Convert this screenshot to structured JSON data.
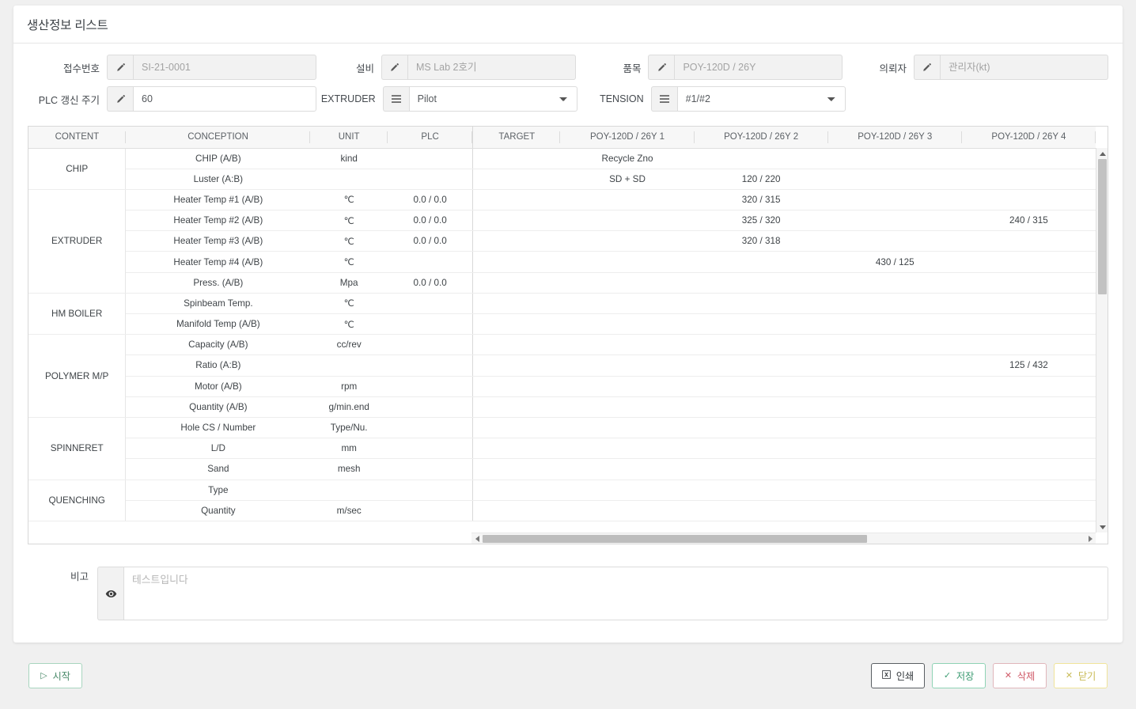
{
  "header": {
    "title": "생산정보 리스트"
  },
  "form": {
    "fields": [
      {
        "label": "접수번호",
        "icon": "pencil-icon",
        "value": "",
        "placeholder": "SI-21-0001",
        "type": "text",
        "readonly": true
      },
      {
        "label": "설비",
        "icon": "pencil-icon",
        "value": "",
        "placeholder": "MS Lab 2호기",
        "type": "text",
        "readonly": true
      },
      {
        "label": "품목",
        "icon": "pencil-icon",
        "value": "",
        "placeholder": "POY-120D / 26Y",
        "type": "text",
        "readonly": true
      },
      {
        "label": "의뢰자",
        "icon": "pencil-icon",
        "value": "",
        "placeholder": "관리자(kt)",
        "type": "text",
        "readonly": true
      },
      {
        "label": "PLC 갱신 주기",
        "icon": "pencil-icon",
        "value": "60",
        "placeholder": "",
        "type": "text",
        "readonly": false
      },
      {
        "label": "EXTRUDER",
        "icon": "list-icon",
        "value": "Pilot",
        "type": "select",
        "options": [
          "Pilot"
        ]
      },
      {
        "label": "TENSION",
        "icon": "list-icon",
        "value": "#1/#2",
        "type": "select",
        "options": [
          "#1/#2"
        ]
      }
    ]
  },
  "table": {
    "columns": [
      "CONTENT",
      "CONCEPTION",
      "UNIT",
      "PLC",
      "TARGET",
      "POY-120D / 26Y 1",
      "POY-120D / 26Y 2",
      "POY-120D / 26Y 3",
      "POY-120D / 26Y 4"
    ],
    "groups": [
      {
        "name": "CHIP",
        "rows": [
          {
            "conception": "CHIP (A/B)",
            "unit": "kind",
            "plc": "",
            "target": "",
            "c1": "Recycle Zno",
            "c2": "",
            "c3": "",
            "c4": ""
          },
          {
            "conception": "Luster (A:B)",
            "unit": "",
            "plc": "",
            "target": "",
            "c1": "SD + SD",
            "c2": "120 / 220",
            "c3": "",
            "c4": ""
          }
        ]
      },
      {
        "name": "EXTRUDER",
        "rows": [
          {
            "conception": "Heater Temp #1 (A/B)",
            "unit": "℃",
            "plc": "0.0 / 0.0",
            "target": "",
            "c1": "",
            "c2": "320 / 315",
            "c3": "",
            "c4": ""
          },
          {
            "conception": "Heater Temp #2 (A/B)",
            "unit": "℃",
            "plc": "0.0 / 0.0",
            "target": "",
            "c1": "",
            "c2": "325 / 320",
            "c3": "",
            "c4": "240 / 315"
          },
          {
            "conception": "Heater Temp #3 (A/B)",
            "unit": "℃",
            "plc": "0.0 / 0.0",
            "target": "",
            "c1": "",
            "c2": "320 / 318",
            "c3": "",
            "c4": ""
          },
          {
            "conception": "Heater Temp #4 (A/B)",
            "unit": "℃",
            "plc": "",
            "target": "",
            "c1": "",
            "c2": "",
            "c3": "430 / 125",
            "c4": ""
          },
          {
            "conception": "Press. (A/B)",
            "unit": "Mpa",
            "plc": "0.0 / 0.0",
            "target": "",
            "c1": "",
            "c2": "",
            "c3": "",
            "c4": ""
          }
        ]
      },
      {
        "name": "HM BOILER",
        "rows": [
          {
            "conception": "Spinbeam Temp.",
            "unit": "℃",
            "plc": "",
            "target": "",
            "c1": "",
            "c2": "",
            "c3": "",
            "c4": ""
          },
          {
            "conception": "Manifold Temp (A/B)",
            "unit": "℃",
            "plc": "",
            "target": "",
            "c1": "",
            "c2": "",
            "c3": "",
            "c4": ""
          }
        ]
      },
      {
        "name": "POLYMER M/P",
        "rows": [
          {
            "conception": "Capacity (A/B)",
            "unit": "cc/rev",
            "plc": "",
            "target": "",
            "c1": "",
            "c2": "",
            "c3": "",
            "c4": ""
          },
          {
            "conception": "Ratio (A:B)",
            "unit": "",
            "plc": "",
            "target": "",
            "c1": "",
            "c2": "",
            "c3": "",
            "c4": "125 / 432"
          },
          {
            "conception": "Motor (A/B)",
            "unit": "rpm",
            "plc": "",
            "target": "",
            "c1": "",
            "c2": "",
            "c3": "",
            "c4": ""
          },
          {
            "conception": "Quantity (A/B)",
            "unit": "g/min.end",
            "plc": "",
            "target": "",
            "c1": "",
            "c2": "",
            "c3": "",
            "c4": ""
          }
        ]
      },
      {
        "name": "SPINNERET",
        "rows": [
          {
            "conception": "Hole CS / Number",
            "unit": "Type/Nu.",
            "plc": "",
            "target": "",
            "c1": "",
            "c2": "",
            "c3": "",
            "c4": ""
          },
          {
            "conception": "L/D",
            "unit": "mm",
            "plc": "",
            "target": "",
            "c1": "",
            "c2": "",
            "c3": "",
            "c4": ""
          },
          {
            "conception": "Sand",
            "unit": "mesh",
            "plc": "",
            "target": "",
            "c1": "",
            "c2": "",
            "c3": "",
            "c4": ""
          }
        ]
      },
      {
        "name": "QUENCHING",
        "rows": [
          {
            "conception": "Type",
            "unit": "",
            "plc": "",
            "target": "",
            "c1": "",
            "c2": "",
            "c3": "",
            "c4": ""
          },
          {
            "conception": "Quantity",
            "unit": "m/sec",
            "plc": "",
            "target": "",
            "c1": "",
            "c2": "",
            "c3": "",
            "c4": ""
          }
        ]
      }
    ]
  },
  "remark": {
    "label": "비고",
    "icon": "eye-icon",
    "value": "",
    "placeholder": "테스트입니다"
  },
  "footer": {
    "start": {
      "label": "시작",
      "icon": "play-icon",
      "color": "#4a8a6a"
    },
    "print": {
      "label": "인쇄",
      "icon": "printer-icon",
      "color": "#33383c"
    },
    "save": {
      "label": "저장",
      "icon": "check-icon",
      "color": "#3f9d74"
    },
    "delete": {
      "label": "삭제",
      "icon": "x-icon",
      "color": "#d05a68"
    },
    "close": {
      "label": "닫기",
      "icon": "x-icon",
      "color": "#c9bb57"
    }
  }
}
